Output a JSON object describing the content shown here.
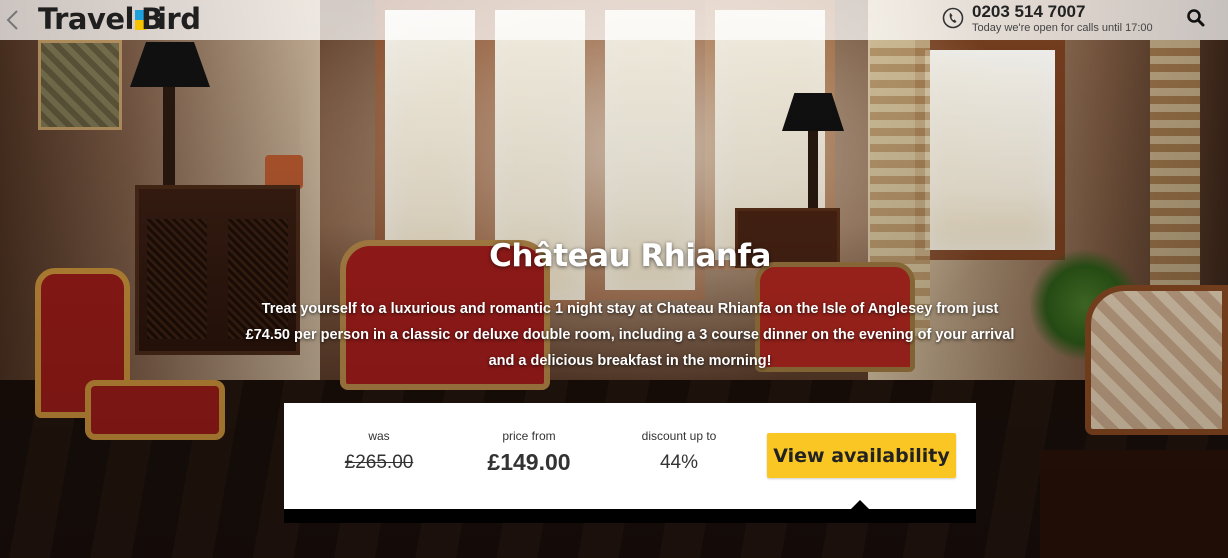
{
  "header": {
    "brand": {
      "text_1": "Travel",
      "text_2": "ird",
      "colors": {
        "blue": "#1ea0dc",
        "yellow": "#f6c300"
      }
    },
    "back_icon": "chevron-left-icon",
    "phone_icon": "phone-icon",
    "phone_number": "0203 514 7007",
    "phone_hours": "Today we're open for calls until 17:00",
    "search_icon": "search-icon"
  },
  "hero": {
    "title": "Château Rhianfa",
    "description": "Treat yourself to a luxurious and romantic 1 night stay at Chateau Rhianfa on the Isle of Anglesey from just £74.50 per person in a classic or deluxe double room, including a 3 course dinner on the evening of your arrival and a delicious breakfast in the morning!"
  },
  "pricing": {
    "was_label": "was",
    "was_value": "£265.00",
    "price_label": "price from",
    "price_value": "£149.00",
    "discount_label": "discount up to",
    "discount_value": "44%",
    "cta_label": "View availability",
    "cta_color": "#f9c623"
  }
}
